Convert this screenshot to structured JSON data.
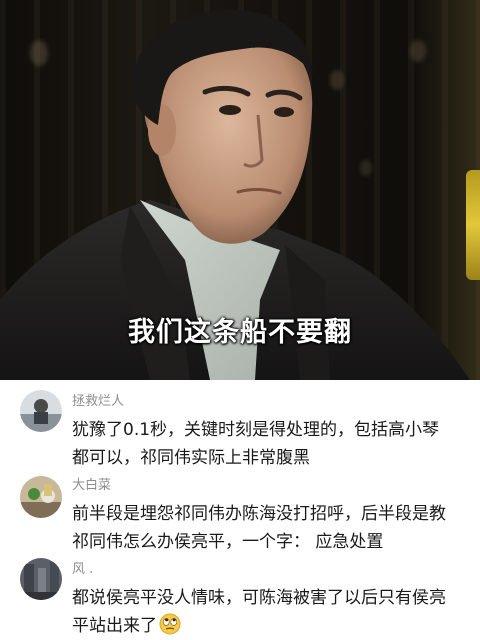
{
  "video_frame": {
    "subtitle": "我们这条船不要翻"
  },
  "comments": [
    {
      "username": "拯救烂人",
      "line1": "犹豫了0.1秒，关键时刻是得处理的，包括高小琴",
      "line2": "都可以，祁同伟实际上非常腹黑"
    },
    {
      "username": "大白菜",
      "line1": "前半段是埋怨祁同伟办陈海没打招呼，后半段是教",
      "line2": "祁同伟怎么办侯亮平，一个字：  应急处置"
    },
    {
      "username": "风 .",
      "line1": "都说侯亮平没人情味，可陈海被害了以后只有侯亮",
      "line2": "平站出来了",
      "emoji": "eye-roll-emoji"
    }
  ],
  "colors": {
    "username": "#8e8e8e",
    "comment_text": "#1a1a1a",
    "subtitle": "#ffffff"
  }
}
